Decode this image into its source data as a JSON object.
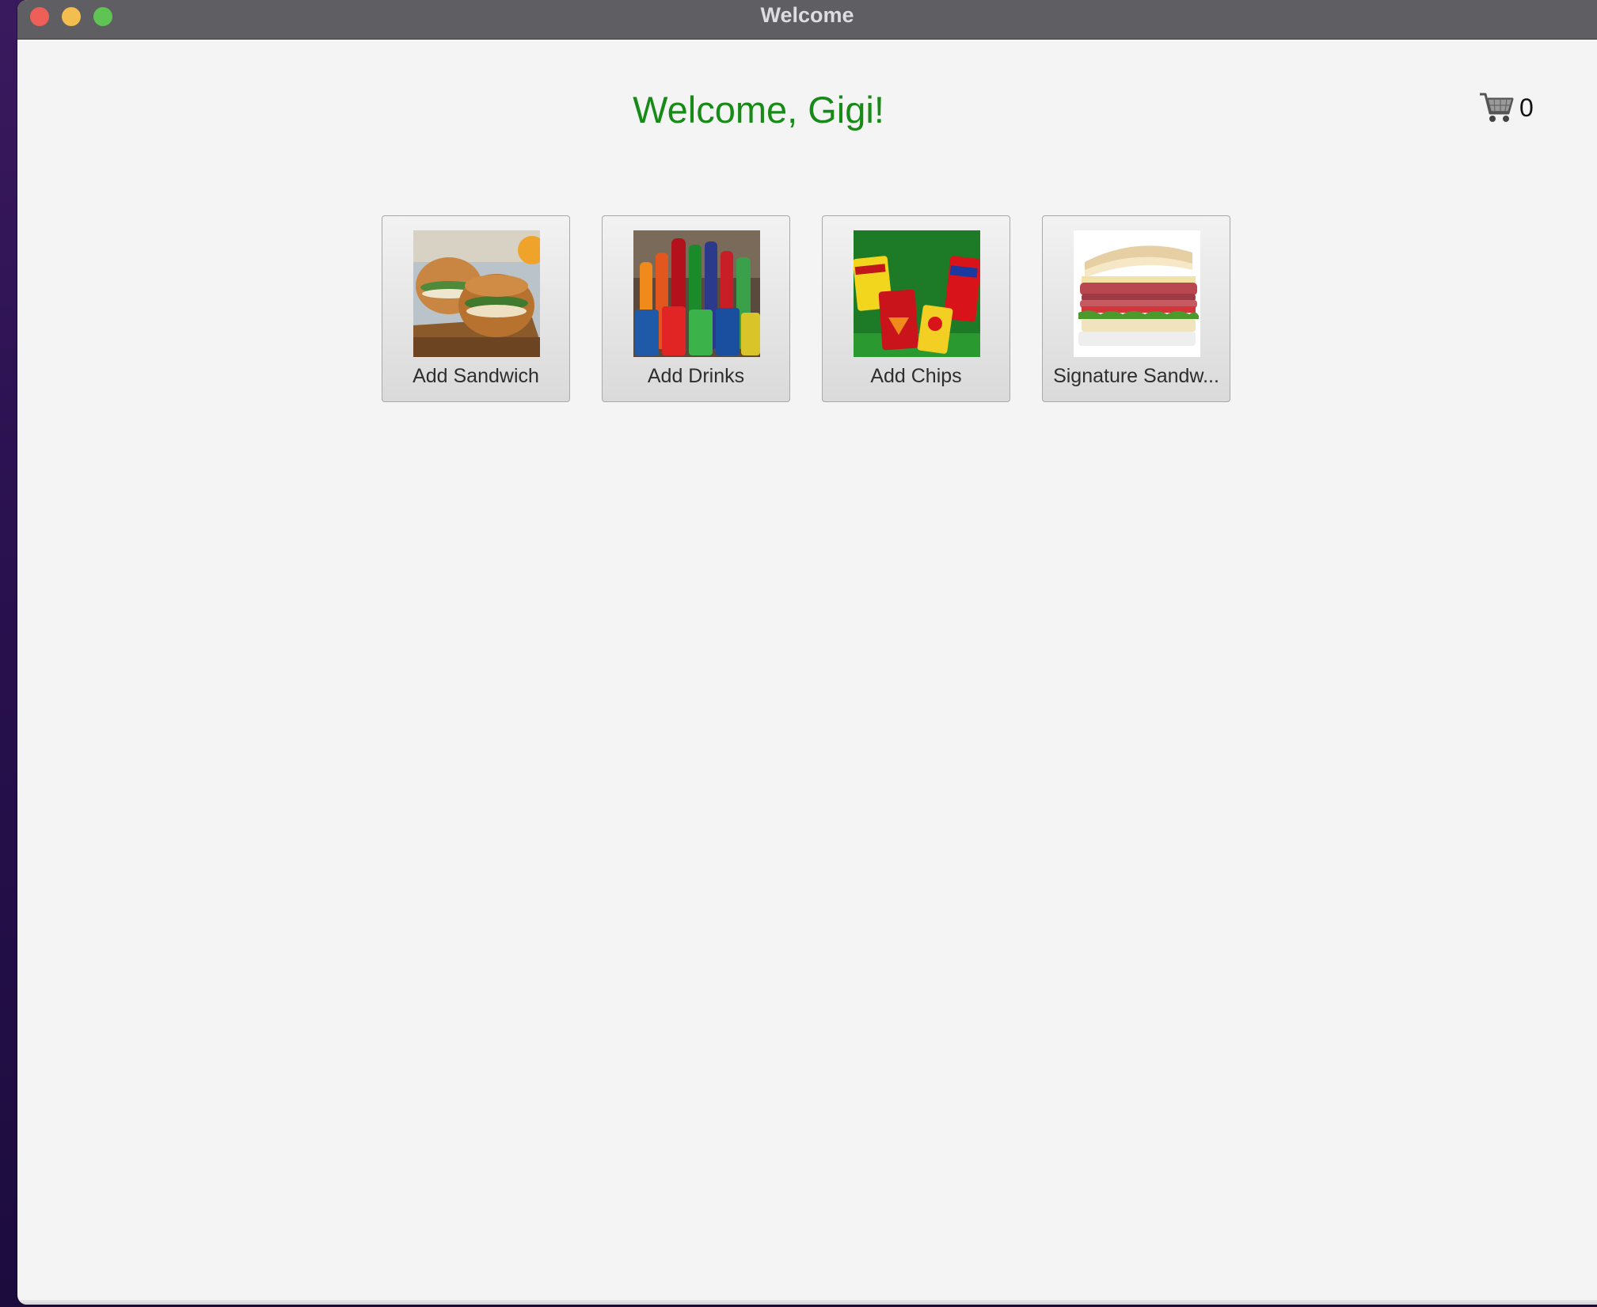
{
  "window": {
    "title": "Welcome"
  },
  "header": {
    "welcome_text": "Welcome, Gigi!",
    "welcome_color": "#178a17"
  },
  "cart": {
    "icon": "cart-icon",
    "count": "0"
  },
  "tiles": [
    {
      "label": "Add Sandwich",
      "image": "sandwich-photo"
    },
    {
      "label": "Add Drinks",
      "image": "drinks-photo"
    },
    {
      "label": "Add Chips",
      "image": "chips-photo"
    },
    {
      "label": "Signature Sandw...",
      "image": "signature-sandwich-photo"
    }
  ]
}
